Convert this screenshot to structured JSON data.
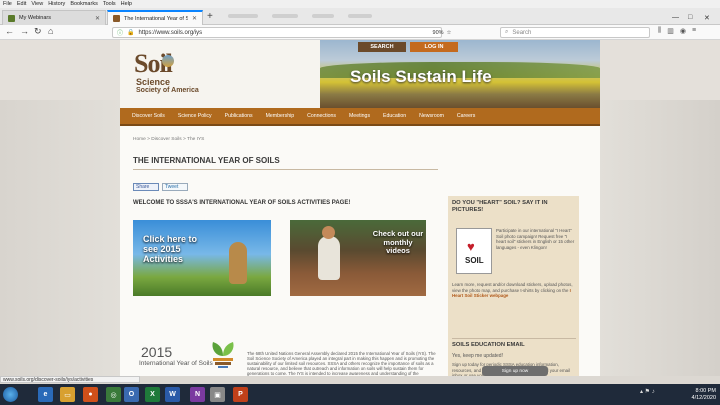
{
  "browser": {
    "menu": [
      "File",
      "Edit",
      "View",
      "History",
      "Bookmarks",
      "Tools",
      "Help"
    ],
    "tabs": [
      {
        "label": "My Webinars"
      },
      {
        "label": "The International Year of Soils"
      }
    ],
    "new_tab": "+",
    "url": "https://www.soils.org/iys",
    "zoom": "90%",
    "search_placeholder": "Search"
  },
  "site": {
    "logo_line1": "Soil",
    "logo_line2": "Science",
    "logo_line3": "Society of America",
    "hero_title": "Soils Sustain Life",
    "header_search": "SEARCH",
    "header_login": "LOG IN",
    "nav": [
      "Discover Soils",
      "Science Policy",
      "Publications",
      "Membership",
      "Connections",
      "Meetings",
      "Education",
      "Newsroom",
      "Careers"
    ]
  },
  "main": {
    "breadcrumb": "Home > Discover Soils > The IYS",
    "title": "THE INTERNATIONAL YEAR OF SOILS",
    "share_label": "Share",
    "tweet_label": "Tweet",
    "welcome": "WELCOME TO SSSA'S INTERNATIONAL YEAR OF SOILS ACTIVITIES PAGE!",
    "promo1_text": "Click here to see 2015 Activities",
    "promo2_text": "Check out our monthly videos",
    "iyos_year": "2015",
    "iyos_sub": "International Year of Soils",
    "body": "The 68th United Nations General Assembly declared 2015 the International Year of Soils (IYS). The Soil Science Society of America played an integral part in making this happen and is promoting the sustainability of our limited soil resources. SSSA and others recognize the importance of soils as a natural resource, and believe that outreach and information on soils will help sustain them for generations to come. The IYS is intended to increase awareness and understanding of the importance of soil for food security and essential ecosystem functions. Through these activities, we hope to raise awareness about soils and how they are a living, breathing ecosystem under our feet."
  },
  "sidebar": {
    "heading1": "DO YOU \"HEART\" SOIL? SAY IT IN PICTURES!",
    "sticker_word": "SOIL",
    "text1": "Participate in our international \"I Heart\" Soil photo campaign! Request free \"I heart soil\" stickers in English or 15 other languages - even Klingon!",
    "text2": "Learn more, request and/or download stickers, upload photos, view the photo map, and purchase t-shirts by clicking on the",
    "link": "I Heart Soil Sticker webpage",
    "heading2": "SOILS EDUCATION EMAIL",
    "stay": "Yes, keep me updated!",
    "text3": "Sign up today for periodic SSSA education information, resources, and materials (don't worry, we won't fill your email inbox or use your email for other purposes).",
    "signup": "Sign up now"
  },
  "status": {
    "url": "www.soils.org/discover-soils/iys/activities"
  },
  "taskbar": {
    "clock_time": "8:00 PM",
    "clock_date": "4/12/2020"
  },
  "colors": {
    "nav_brown": "#b06a1e",
    "logo_brown": "#6b4a2b",
    "login_orange": "#c46a1e"
  }
}
